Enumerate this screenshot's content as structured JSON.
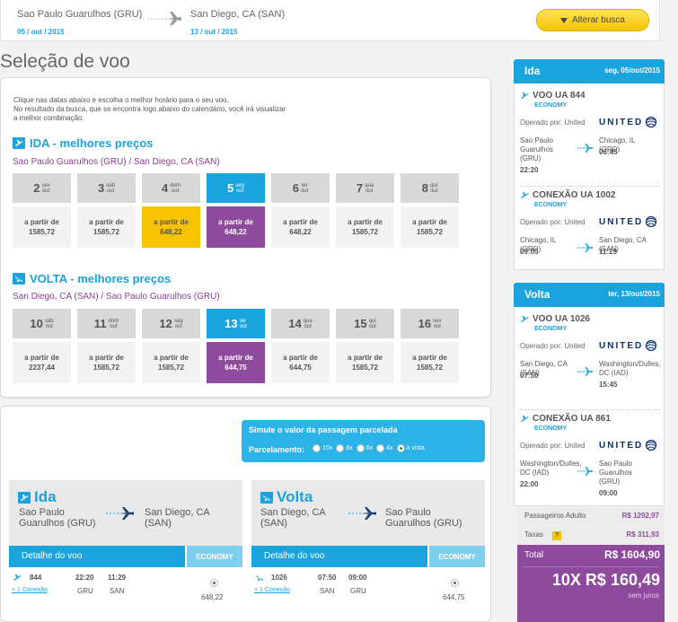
{
  "search_bar": {
    "origin": "Sao Paulo Guarulhos (GRU)",
    "destination": "San Diego, CA (SAN)",
    "depart_date": "05 / out / 2015",
    "return_date": "13 / out / 2015",
    "alter_button": "Alterar busca"
  },
  "page_title": "Seleção de voo",
  "instructions": [
    "Clique nas datas abaixo e escolha o melhor horário para o seu voo.",
    "No resultado da busca, que se encontra logo abaixo do calendário, você irá visualizar",
    "a melhor combinação."
  ],
  "price_prefix": "a partir de",
  "outbound_calendar": {
    "title": "IDA - melhores preços",
    "route": "Sao Paulo Guarulhos (GRU) / San Diego, CA (SAN)",
    "days": [
      {
        "day": "2",
        "weekday": "sex",
        "month": "out",
        "price": "1585,72",
        "state": "normal"
      },
      {
        "day": "3",
        "weekday": "sáb",
        "month": "out",
        "price": "1585,72",
        "state": "normal"
      },
      {
        "day": "4",
        "weekday": "dom",
        "month": "out",
        "price": "648,22",
        "state": "cheapest"
      },
      {
        "day": "5",
        "weekday": "seg",
        "month": "out",
        "price": "648,22",
        "state": "selected"
      },
      {
        "day": "6",
        "weekday": "ter",
        "month": "out",
        "price": "648,22",
        "state": "normal"
      },
      {
        "day": "7",
        "weekday": "qua",
        "month": "out",
        "price": "1585,72",
        "state": "normal"
      },
      {
        "day": "8",
        "weekday": "qui",
        "month": "out",
        "price": "1585,72",
        "state": "normal"
      }
    ]
  },
  "return_calendar": {
    "title": "VOLTA - melhores preços",
    "route": "San Diego, CA (SAN) / Sao Paulo Guarulhos (GRU)",
    "days": [
      {
        "day": "10",
        "weekday": "sáb",
        "month": "out",
        "price": "2237,44",
        "state": "normal"
      },
      {
        "day": "11",
        "weekday": "dom",
        "month": "out",
        "price": "1585,72",
        "state": "normal"
      },
      {
        "day": "12",
        "weekday": "seg",
        "month": "out",
        "price": "1585,72",
        "state": "normal"
      },
      {
        "day": "13",
        "weekday": "ter",
        "month": "out",
        "price": "644,75",
        "state": "selected"
      },
      {
        "day": "14",
        "weekday": "qua",
        "month": "out",
        "price": "644,75",
        "state": "normal"
      },
      {
        "day": "15",
        "weekday": "qui",
        "month": "out",
        "price": "1585,72",
        "state": "normal"
      },
      {
        "day": "16",
        "weekday": "sex",
        "month": "out",
        "price": "1585,72",
        "state": "normal"
      }
    ]
  },
  "installments": {
    "title": "Simule o valor da passagem parcelada",
    "label": "Parcelamento:",
    "options": [
      {
        "label": "10x",
        "selected": false
      },
      {
        "label": "8x",
        "selected": false
      },
      {
        "label": "6x",
        "selected": false
      },
      {
        "label": "4x",
        "selected": false
      },
      {
        "label": "à vista",
        "selected": true
      }
    ]
  },
  "legs": [
    {
      "title": "Ida",
      "from": "Sao Paulo Guarulhos (GRU)",
      "to": "San Diego, CA (SAN)",
      "detail_label": "Detalhe do voo",
      "class_label": "ECONOMY",
      "flight": "844",
      "connection": "+ 1 Conexão",
      "dep_time": "22:20",
      "arr_time": "11:29",
      "dep_code": "GRU",
      "arr_code": "SAN",
      "price": "648,22"
    },
    {
      "title": "Volta",
      "from": "San Diego, CA (SAN)",
      "to": "Sao Paulo Guarulhos (GRU)",
      "detail_label": "Detalhe do voo",
      "class_label": "ECONOMY",
      "flight": "1026",
      "connection": "+ 1 Conexão",
      "dep_time": "07:50",
      "arr_time": "09:00",
      "dep_code": "SAN",
      "arr_code": "GRU",
      "price": "644,75"
    }
  ],
  "summary": {
    "outbound": {
      "label": "Ida",
      "date": "seg, 05/out/2015",
      "segments": [
        {
          "code": "VOO UA 844",
          "class": "ECONOMY",
          "operated": "Operado por: United",
          "airline": "UNITED",
          "from_city": "Sao Paulo Guarulhos",
          "from_code": "(GRU)",
          "from_time": "22:20",
          "to_city": "Chicago, IL",
          "to_code": "(ORD)",
          "to_time": "06:45"
        },
        {
          "code": "CONEXÃO UA 1002",
          "class": "ECONOMY",
          "operated": "Operado por: United",
          "airline": "UNITED",
          "from_city": "Chicago, IL",
          "from_code": "(ORD)",
          "from_time": "09:05",
          "to_city": "San Diego, CA",
          "to_code": "(SAN)",
          "to_time": "11:29"
        }
      ]
    },
    "return": {
      "label": "Volta",
      "date": "ter, 13/out/2015",
      "segments": [
        {
          "code": "VOO UA 1026",
          "class": "ECONOMY",
          "operated": "Operado por: United",
          "airline": "UNITED",
          "from_city": "San Diego, CA",
          "from_code": "(SAN)",
          "from_time": "07:50",
          "to_city": "Washington/Dulles, DC (IAD)",
          "to_code": "",
          "to_time": "15:45"
        },
        {
          "code": "CONEXÃO UA 861",
          "class": "ECONOMY",
          "operated": "Operado por: United",
          "airline": "UNITED",
          "from_city": "Washington/Dulles, DC (IAD)",
          "from_code": "",
          "from_time": "22:00",
          "to_city": "Sao Paulo Guarulhos",
          "to_code": "(GRU)",
          "to_time": "09:00"
        }
      ]
    },
    "adult_label": "Passageiros Adulto",
    "adult_value": "R$ 1292,97",
    "tax_label": "Taxas",
    "tax_value": "R$ 311,93",
    "total_label": "Total",
    "total_value": "R$ 1604,90",
    "installment_value": "10X R$ 160,49",
    "installment_note": "sem juros"
  },
  "colors": {
    "accent": "#1aa4de",
    "selected": "#8e4a9c",
    "cheapest": "#f8c400"
  }
}
